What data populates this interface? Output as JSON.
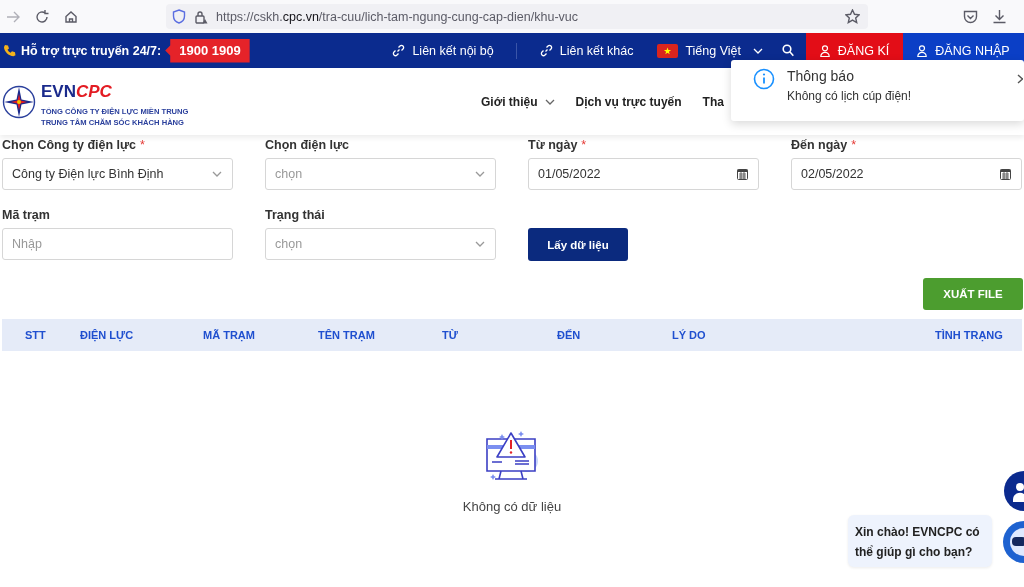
{
  "browser": {
    "url": "https://cskh.**cpc.vn**/tra-cuu/lich-tam-ngung-cung-cap-dien/khu-vuc"
  },
  "top_bar": {
    "support_label": "Hỗ trợ trực truyến 24/7:",
    "hotline": "1900 1909",
    "links": [
      "Liên kết nội bộ",
      "Liên kết khác"
    ],
    "language": "Tiếng Việt",
    "register": "ĐĂNG KÍ",
    "login": "ĐĂNG NHẬP"
  },
  "header": {
    "logo": {
      "brand_main": "EVN",
      "brand_accent": "CPC",
      "line_1": "TỔNG CÔNG TY ĐIỆN LỰC MIỀN TRUNG",
      "line_2": "TRUNG TÂM CHĂM SÓC KHÁCH HÀNG"
    },
    "nav": [
      {
        "label": "Giới thiệu",
        "dropdown": true
      },
      {
        "label": "Dịch vụ trực tuyến",
        "dropdown": false
      },
      {
        "label": "Tha",
        "dropdown": false
      }
    ]
  },
  "filters": [
    {
      "kind": "select",
      "label": "Chọn Công ty điện lực",
      "required_mark": "*",
      "value": "Công ty Điện lực Bình Định"
    },
    {
      "kind": "select",
      "label": "Chọn điện lực",
      "placeholder": "chọn"
    },
    {
      "kind": "date",
      "label": "Từ ngày",
      "required_mark": "*",
      "value": "01/05/2022"
    },
    {
      "kind": "date",
      "label": "Đến ngày",
      "required_mark": "*",
      "value": "02/05/2022"
    },
    {
      "kind": "text",
      "label": "Mã trạm",
      "placeholder": "Nhập"
    },
    {
      "kind": "select",
      "label": "Trạng thái",
      "placeholder": "chọn"
    },
    {
      "kind": "button",
      "label": "Lấy dữ liệu"
    }
  ],
  "export_button": "XUẤT FILE",
  "table": {
    "columns": [
      "STT",
      "ĐIỆN LỰC",
      "MÃ TRẠM",
      "TÊN TRẠM",
      "TỪ",
      "ĐẾN",
      "LÝ DO",
      "TÌNH TRẠNG"
    ]
  },
  "empty_message": "Không có dữ liệu",
  "toast": {
    "title": "Thông báo",
    "message": "Không có lịch cúp điện!"
  },
  "chat": {
    "greeting": "Xin chào! EVNCPC có thể giúp gì cho bạn?"
  }
}
